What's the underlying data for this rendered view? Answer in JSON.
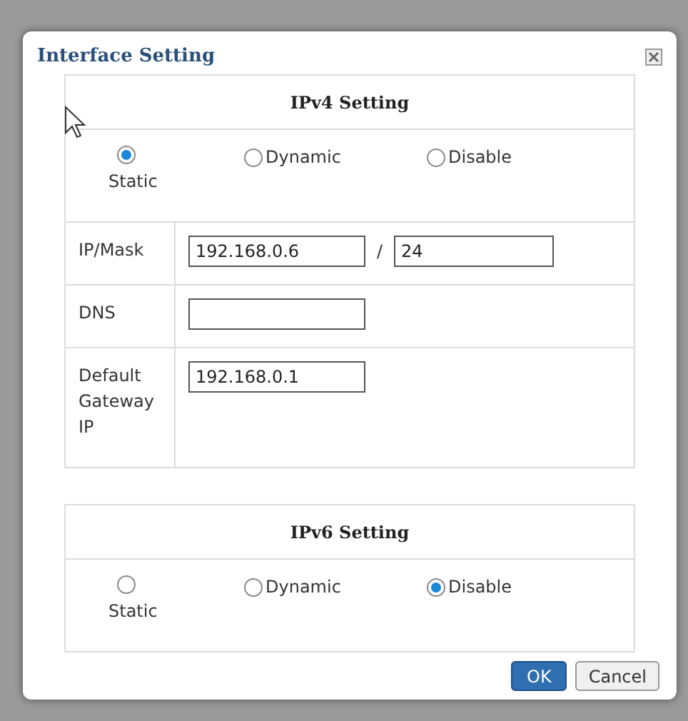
{
  "dialog": {
    "title": "Interface Setting"
  },
  "ipv4": {
    "title": "IPv4 Setting",
    "modes": [
      {
        "label": "Static",
        "selected": true,
        "kind": "stacked"
      },
      {
        "label": "Dynamic",
        "selected": false,
        "kind": "inline"
      },
      {
        "label": "Disable",
        "selected": false,
        "kind": "inline"
      }
    ],
    "fields": [
      {
        "label": "IP/Mask",
        "value": "192.168.0.6",
        "separator": "/",
        "suffix_value": "24"
      },
      {
        "label": "DNS"
      },
      {
        "label": "Default Gateway IP",
        "value": "192.168.0.1"
      }
    ]
  },
  "ipv6": {
    "title": "IPv6 Setting",
    "modes": [
      {
        "label": "Static",
        "selected": false,
        "kind": "stacked"
      },
      {
        "label": "Dynamic",
        "selected": false,
        "kind": "inline"
      },
      {
        "label": "Disable",
        "selected": true,
        "kind": "inline"
      }
    ]
  },
  "buttons": [
    {
      "label": "OK",
      "kind": "primary"
    },
    {
      "label": "Cancel",
      "kind": "secondary"
    }
  ]
}
